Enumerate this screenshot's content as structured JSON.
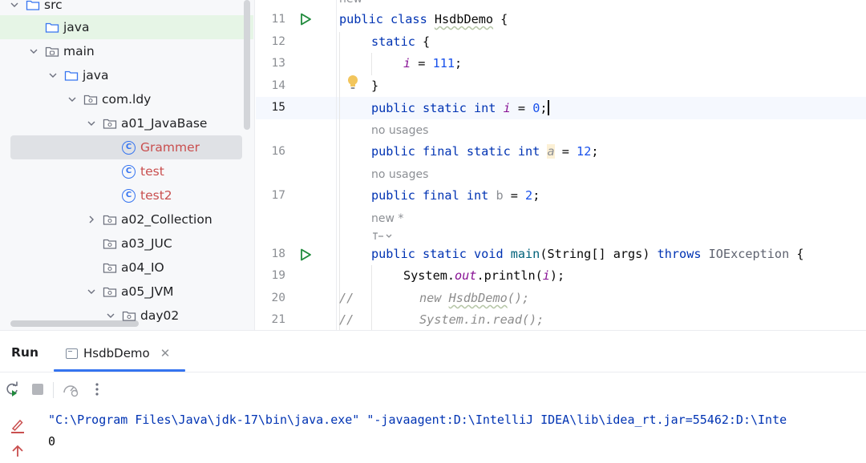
{
  "tree": {
    "items": [
      {
        "label": "src",
        "expanded": true,
        "icon": "folder-blue-icon"
      },
      {
        "label": "java",
        "icon": "folder-blue-icon"
      },
      {
        "label": "main",
        "expanded": true,
        "icon": "folder-module-icon"
      },
      {
        "label": "java",
        "expanded": true,
        "icon": "folder-blue-icon"
      },
      {
        "label": "com.ldy",
        "expanded": true,
        "icon": "package-icon"
      },
      {
        "label": "a01_JavaBase",
        "expanded": true,
        "icon": "package-icon"
      },
      {
        "label": "Grammer",
        "icon": "class-icon",
        "selected": true
      },
      {
        "label": "test",
        "icon": "class-icon"
      },
      {
        "label": "test2",
        "icon": "class-icon"
      },
      {
        "label": "a02_Collection",
        "expanded": false,
        "icon": "package-icon"
      },
      {
        "label": "a03_JUC",
        "icon": "package-icon"
      },
      {
        "label": "a04_IO",
        "icon": "package-icon"
      },
      {
        "label": "a05_JVM",
        "expanded": true,
        "icon": "package-icon"
      },
      {
        "label": "day02",
        "expanded": true,
        "icon": "package-icon"
      }
    ]
  },
  "editor": {
    "line_numbers": [
      "11",
      "12",
      "13",
      "14",
      "15",
      "16",
      "17",
      "18",
      "19",
      "20",
      "21"
    ],
    "current_line": "15",
    "hints": {
      "top_new": "new",
      "no_usages_1": "no usages",
      "no_usages_2": "no usages",
      "new_star": "new *"
    },
    "lines": {
      "l11_kw": "public class ",
      "l11_name": "HsdbDemo",
      "l11_rest": " {",
      "l12_kw": "static",
      "l12_rest": " {",
      "l13_var": "i",
      "l13_eq": " = ",
      "l13_num": "111",
      "l13_end": ";",
      "l14": "}",
      "l15_kw": "public static int ",
      "l15_var": "i",
      "l15_eq": " = ",
      "l15_num": "0",
      "l15_end": ";",
      "l16_kw": "public final static int ",
      "l16_var": "a",
      "l16_eq": " = ",
      "l16_num": "12",
      "l16_end": ";",
      "l17_kw": "public final int ",
      "l17_var": "b",
      "l17_eq": " = ",
      "l17_num": "2",
      "l17_end": ";",
      "l18_kw": "public static void ",
      "l18_meth": "main",
      "l18_args": "(String[] args) ",
      "l18_throws": "throws ",
      "l18_exc": "IOException",
      "l18_end": " {",
      "l19_a": "System.",
      "l19_out": "out",
      "l19_b": ".println(",
      "l19_var": "i",
      "l19_c": ");",
      "l20_cmt": "//",
      "l20_code": "new HsdbDemo();",
      "l20_pre": "new ",
      "l20_cls": "HsdbDemo",
      "l20_post": "();",
      "l21_cmt": "//",
      "l21_code": "System.in.read();"
    }
  },
  "run_panel": {
    "title": "Run",
    "tab_label": "HsdbDemo",
    "console": {
      "command": "\"C:\\Program Files\\Java\\jdk-17\\bin\\java.exe\" \"-javaagent:D:\\IntelliJ IDEA\\lib\\idea_rt.jar=55462:D:\\Inte",
      "output": "0"
    }
  },
  "colors": {
    "accent": "#3574f0",
    "run_green": "#208a3c",
    "keyword": "#0033b3",
    "number": "#1750eb",
    "field": "#871094",
    "red_file": "#c94f4f"
  }
}
